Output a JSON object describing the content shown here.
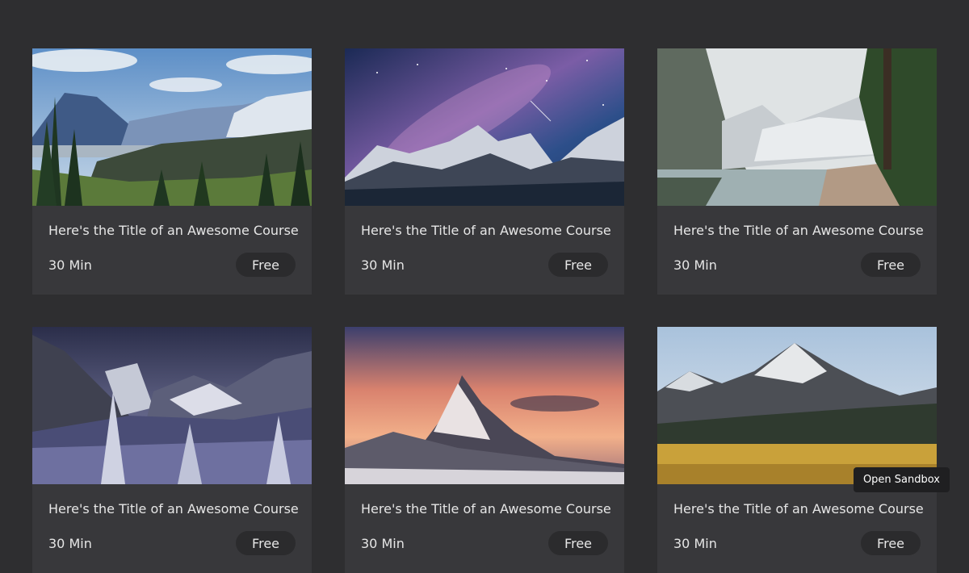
{
  "courses": [
    {
      "title": "Here's the Title of an Awesome Course",
      "duration": "30 Min",
      "price": "Free",
      "image": "mountain-valley-forest-image"
    },
    {
      "title": "Here's the Title of an Awesome Course",
      "duration": "30 Min",
      "price": "Free",
      "image": "milky-way-mountains-image"
    },
    {
      "title": "Here's the Title of an Awesome Course",
      "duration": "30 Min",
      "price": "Free",
      "image": "alpine-lake-reflection-image"
    },
    {
      "title": "Here's the Title of an Awesome Course",
      "duration": "30 Min",
      "price": "Free",
      "image": "snowy-valley-night-image"
    },
    {
      "title": "Here's the Title of an Awesome Course",
      "duration": "30 Min",
      "price": "Free",
      "image": "peak-at-sunset-image"
    },
    {
      "title": "Here's the Title of an Awesome Course",
      "duration": "30 Min",
      "price": "Free",
      "image": "mountain-golden-field-image"
    }
  ],
  "sandbox_button": "Open Sandbox",
  "colors": {
    "page_background": "#2e2e30",
    "card_background": "#38383b",
    "pill_background": "#2b2b2d",
    "text": "#e6e6e6"
  }
}
